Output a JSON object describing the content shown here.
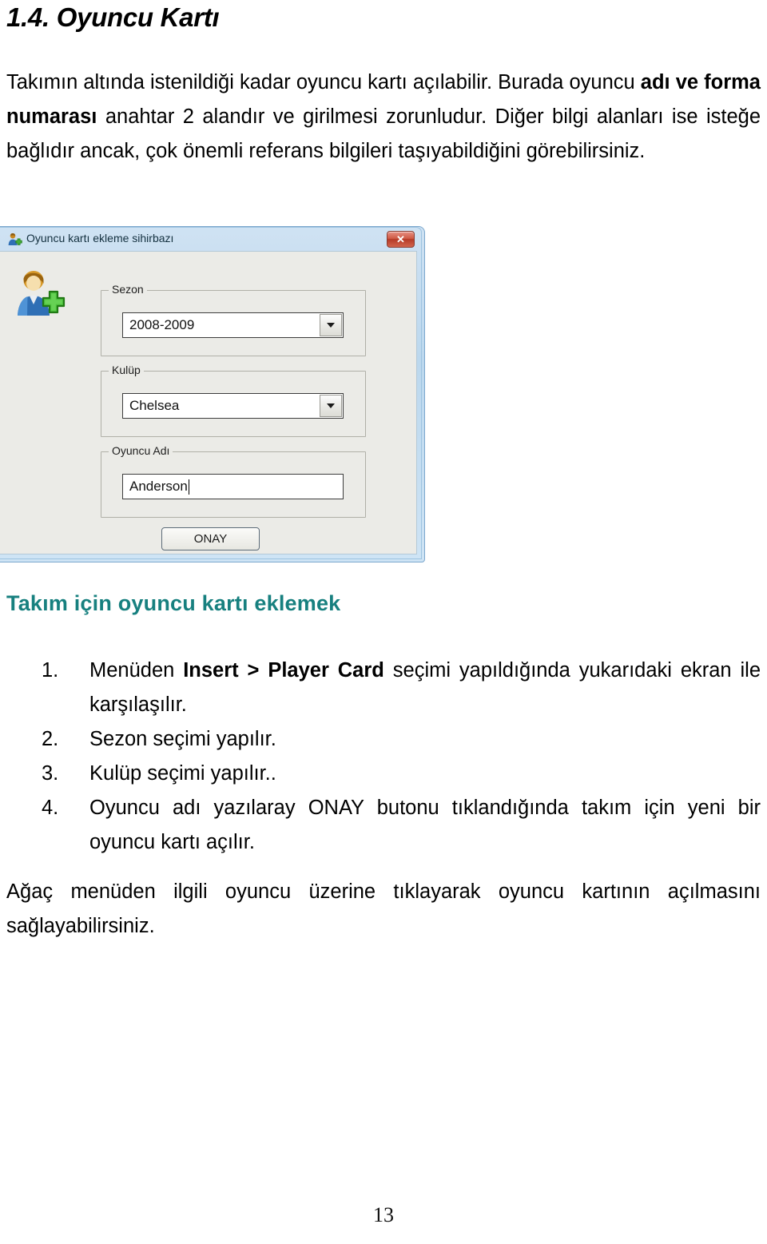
{
  "section": {
    "heading": "1.4. Oyuncu Kartı",
    "intro_html": "Takımın altında istenildiği kadar oyuncu kartı açılabilir. Burada oyuncu <b>adı ve forma numarası</b> anahtar 2 alandır ve girilmesi zorunludur. Diğer bilgi alanları ise isteğe bağlıdır ancak, çok önemli referans bilgileri taşıyabildiğini görebilirsiniz."
  },
  "dialog": {
    "title": "Oyuncu kartı ekleme sihirbazı",
    "title_icon": "add-user-icon",
    "close_label": "✕",
    "close_icon": "close-icon",
    "body_icon": "add-user-large-icon",
    "groups": [
      {
        "legend": "Sezon",
        "control": "combobox",
        "value": "2008-2009"
      },
      {
        "legend": "Kulüp",
        "control": "combobox",
        "value": "Chelsea"
      },
      {
        "legend": "Oyuncu Adı",
        "control": "textbox",
        "value": "Anderson"
      }
    ],
    "submit_label": "ONAY",
    "colors": {
      "window_border": "#7ba7cd",
      "client_bg": "#ebebe7",
      "close_red": "#b53a27"
    }
  },
  "subsection": {
    "heading": "Takım için oyuncu kartı eklemek",
    "heading_color": "#17807f",
    "steps": [
      {
        "num": "1.",
        "html": "Menüden <b>Insert &gt; Player Card</b> seçimi yapıldığında yukarıdaki ekran ile karşılaşılır."
      },
      {
        "num": "2.",
        "html": "Sezon seçimi yapılır."
      },
      {
        "num": "3.",
        "html": "Kulüp seçimi yapılır.."
      },
      {
        "num": "4.",
        "html": "Oyuncu adı yazılaray ONAY butonu tıklandığında takım için yeni bir oyuncu kartı açılır."
      }
    ],
    "closing_html": "Ağaç menüden ilgili oyuncu üzerine tıklayarak oyuncu kartının açılmasını sağlayabilirsiniz."
  },
  "footer": {
    "page_number": "13"
  }
}
